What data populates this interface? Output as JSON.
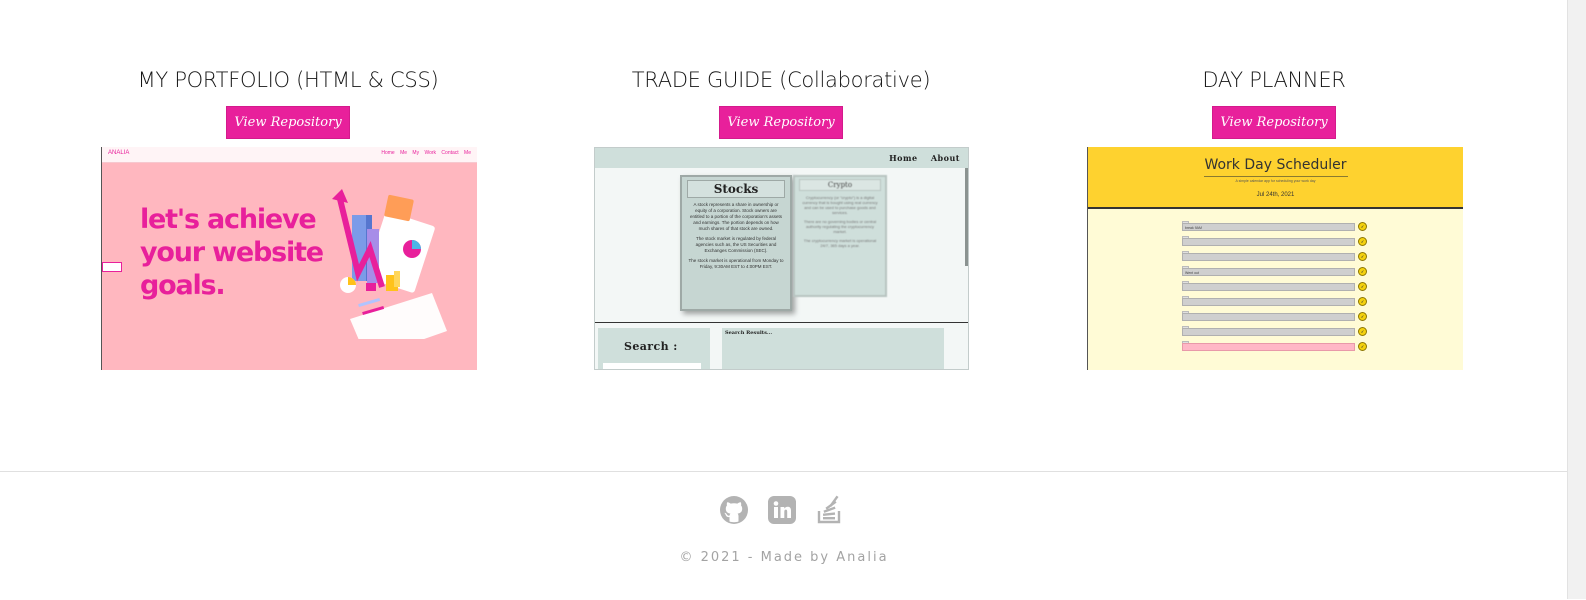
{
  "projects": [
    {
      "title": "MY PORTFOLIO (HTML & CSS)",
      "button_label": "View Repository",
      "preview": {
        "logo": "ANALIA",
        "nav": "Home Me   My Work   Contact Me",
        "headline": "let's achieve your website goals."
      }
    },
    {
      "title": "TRADE GUIDE (Collaborative)",
      "button_label": "View Repository",
      "preview": {
        "nav": "Home About",
        "stocks_title": "Stocks",
        "stocks_text": "A stock represents a share in ownership or equity of a corporation. Stock owners are entitled to a portion of the corporation's assets and earnings. The portion depends on how much shares of that stock are owned.",
        "stocks_text2": "The stock market is regulated by federal agencies such as, the US Securities and Exchanges Commission (SEC).",
        "stocks_text3": "The stock market is operational from Monday to Friday, 9:30AM EST to 4:00PM EST.",
        "crypto_title": "Crypto",
        "crypto_text": "Cryptocurrency (or \"crypto\") is a digital currency that is bought using real currency and can be used to purchase goods and services.",
        "crypto_text2": "There are no governing bodies or central authority regulating the cryptocurrency market.",
        "crypto_text3": "The cryptocurrency market is operational 24/7, 365 days a year.",
        "search_label": "Search :",
        "results_label": "Search Results..."
      }
    },
    {
      "title": "DAY PLANNER",
      "button_label": "View Repository",
      "preview": {
        "title": "Work Day Scheduler",
        "subtitle": "A simple calendar app for scheduling your work day",
        "date": "Jul 24th, 2021",
        "rows": [
          "break 9AM",
          "",
          "",
          "Went out",
          "",
          "",
          "",
          "",
          ""
        ]
      }
    }
  ],
  "footer": {
    "social_icons": [
      "github-icon",
      "linkedin-icon",
      "stackoverflow-icon"
    ],
    "copyright": "© 2021 - Made by Analia"
  },
  "colors": {
    "accent": "#e8209b",
    "icon_gray": "#b3b3b3",
    "planner_yellow": "#fed22f"
  }
}
